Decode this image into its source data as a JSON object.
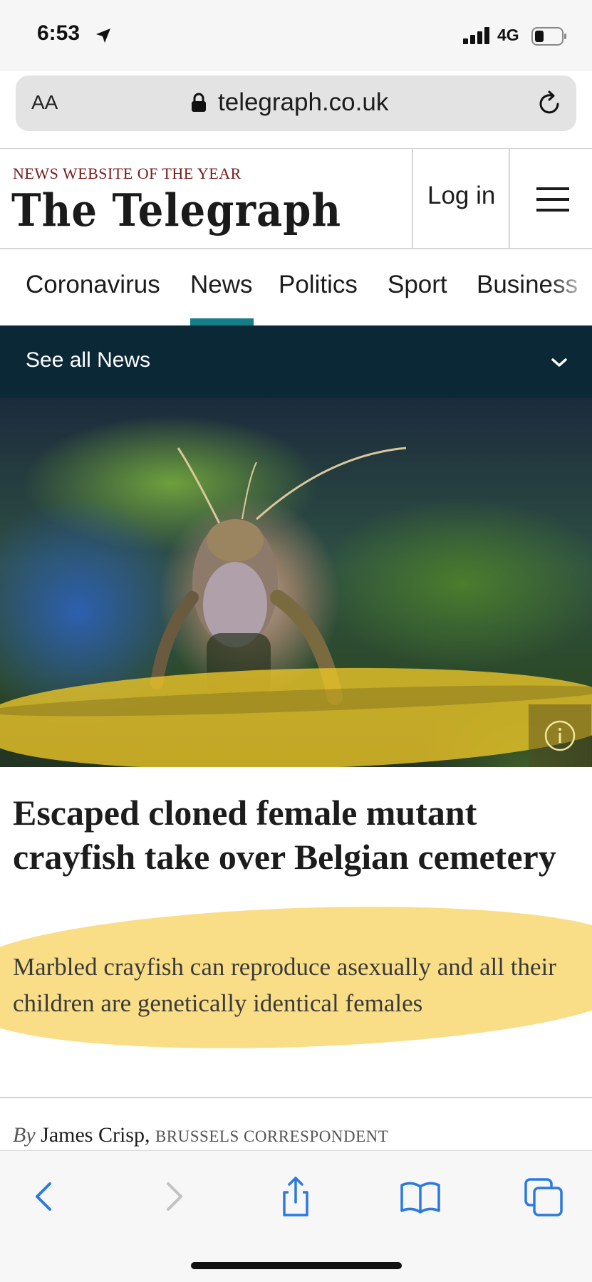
{
  "status_bar": {
    "time": "6:53",
    "network": "4G"
  },
  "browser": {
    "text_size_label": "AA",
    "url": "telegraph.co.uk"
  },
  "masthead": {
    "tagline": "NEWS WEBSITE OF THE YEAR",
    "logo": "The Telegraph",
    "login_label": "Log in"
  },
  "nav": {
    "items": [
      "Coronavirus",
      "News",
      "Politics",
      "Sport",
      "Business"
    ],
    "active": "News",
    "accent_color": "#167e88"
  },
  "subnav": {
    "label": "See all News",
    "background_color": "#0b2837"
  },
  "article": {
    "headline": "Escaped cloned female mutant crayfish take over Belgian cemetery",
    "standfirst": "Marbled crayfish can reproduce asexually and all their children are genetically identical females",
    "byline_prefix": "By",
    "author": "James Crisp,",
    "author_role": "BRUSSELS CORRESPONDENT"
  },
  "highlight_color": "#f0c828",
  "toolbar": {
    "icons": [
      "back-icon",
      "forward-icon",
      "share-icon",
      "bookmarks-icon",
      "tabs-icon"
    ]
  }
}
